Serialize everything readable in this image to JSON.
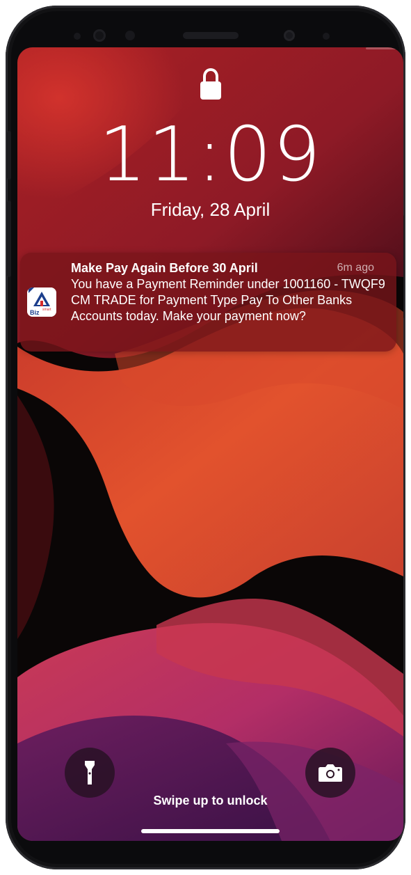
{
  "lock_screen": {
    "time": "11:09",
    "date": "Friday, 28 April",
    "swipe_hint": "Swipe up to unlock"
  },
  "notification": {
    "app_name_text": "Biz",
    "app_icon_sup": "smart",
    "title": "Make Pay Again Before 30 April",
    "timestamp": "6m ago",
    "body": "You have a Payment Reminder under 1001160 - TWQF9 CM TRADE for Payment Type Pay To Other Banks Accounts today. Make your payment now?"
  },
  "quick_actions": {
    "left_icon": "flashlight-icon",
    "right_icon": "camera-icon"
  },
  "colors": {
    "notification_bg": "#78141a",
    "wallpaper_base": "#0a0606",
    "wallpaper_red": "#b3262a",
    "wallpaper_orange": "#e0502c",
    "wallpaper_magenta": "#b2306a"
  }
}
